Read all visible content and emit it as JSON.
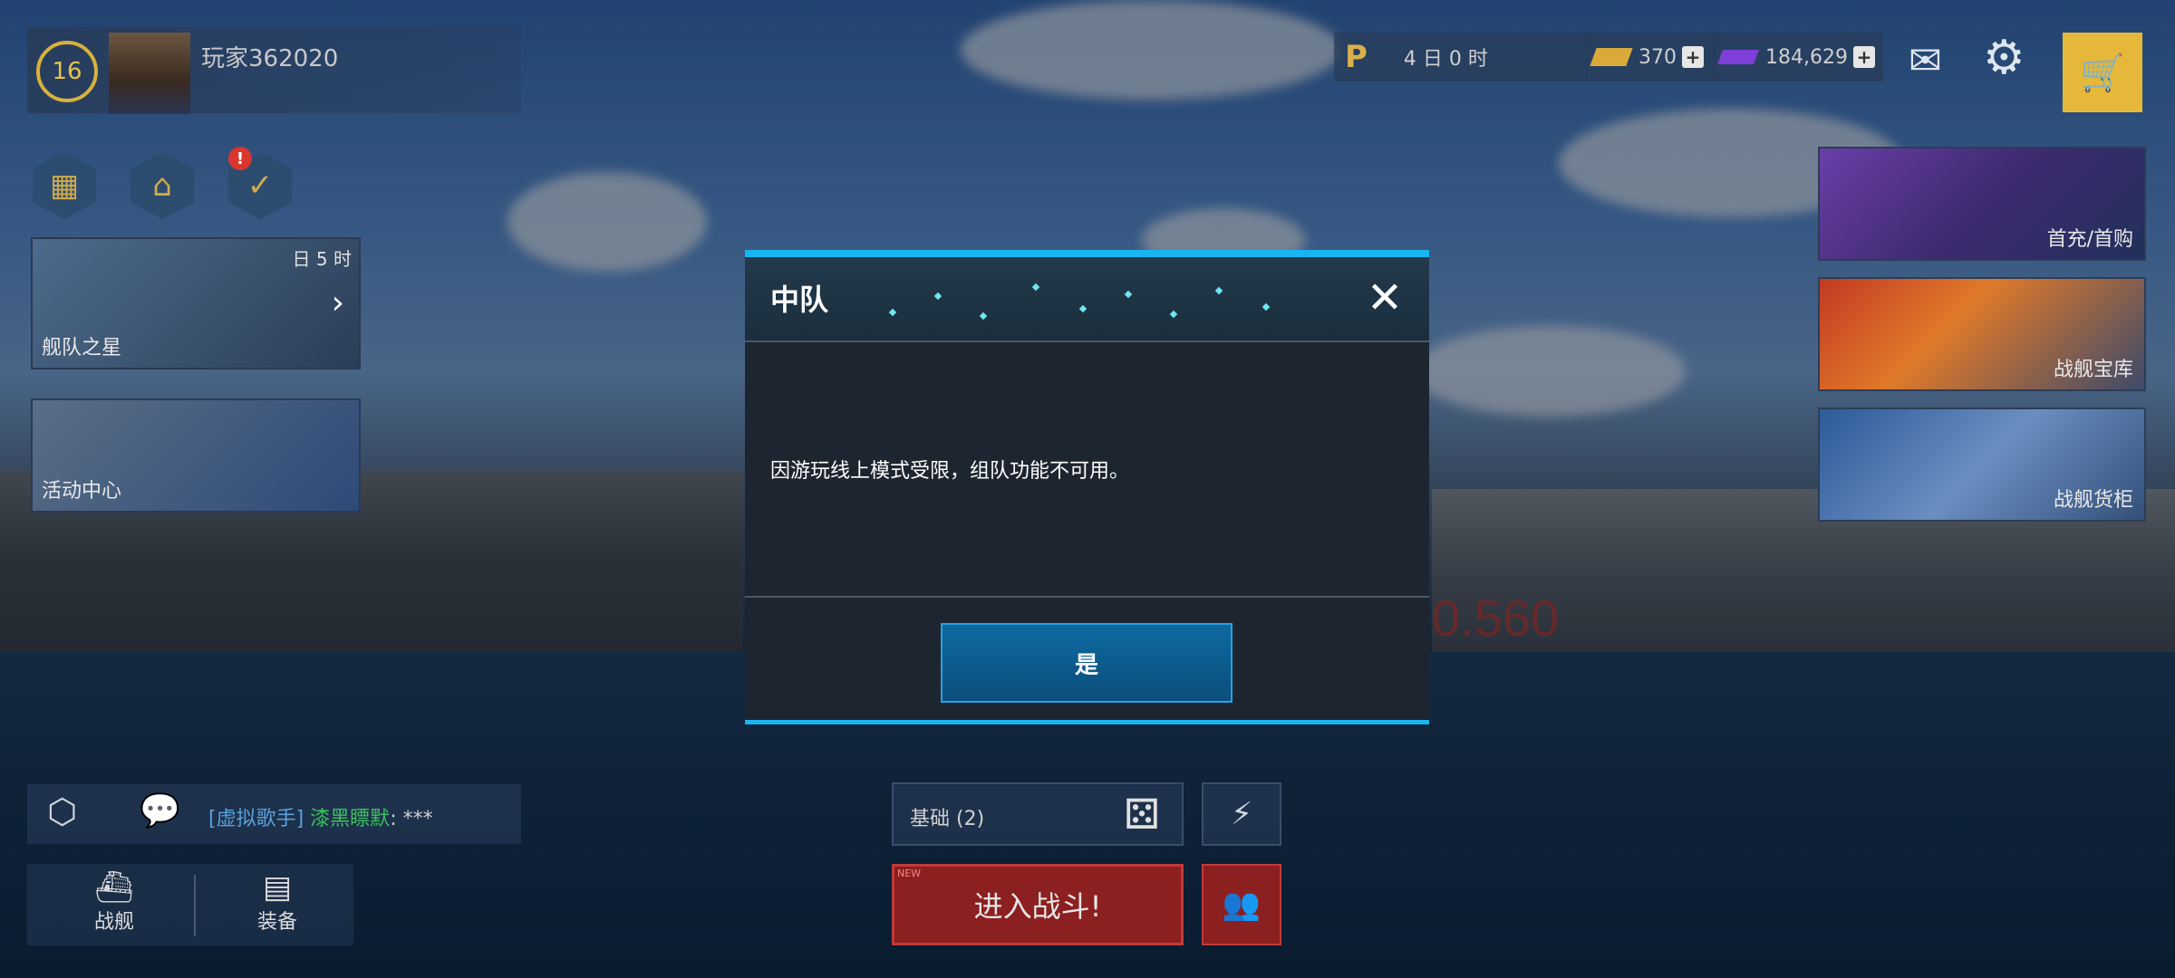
{
  "player": {
    "level": "16",
    "name": "玩家362020"
  },
  "left_icons": [
    {
      "name": "calendar-icon"
    },
    {
      "name": "basket-icon"
    },
    {
      "name": "clipboard-icon",
      "badge": "!"
    }
  ],
  "promos": [
    {
      "label": "舰队之星",
      "timer": "日 5 时"
    },
    {
      "label": "活动中心"
    }
  ],
  "resources": {
    "pass_timer": "4 日 0 时",
    "gold": "370",
    "silver": "184,629"
  },
  "right_cards": [
    "首充/首购",
    "战舰宝库",
    "战舰货柜"
  ],
  "chat": {
    "tag": "[虚拟歌手]",
    "user": "漆黑瞟默",
    "message": ": ***"
  },
  "nav": {
    "ships": "战舰",
    "equipment": "装备"
  },
  "mode": {
    "label": "基础 (2)"
  },
  "battle_label": "进入战斗!",
  "battle_badge": "NEW",
  "background_text": "0.560",
  "dialog": {
    "title": "中队",
    "message": "因游玩线上模式受限，组队功能不可用。",
    "confirm": "是"
  },
  "colors": {
    "accent": "#19b5f0",
    "gold": "#e5b83a",
    "battle": "#8c1f1f"
  }
}
